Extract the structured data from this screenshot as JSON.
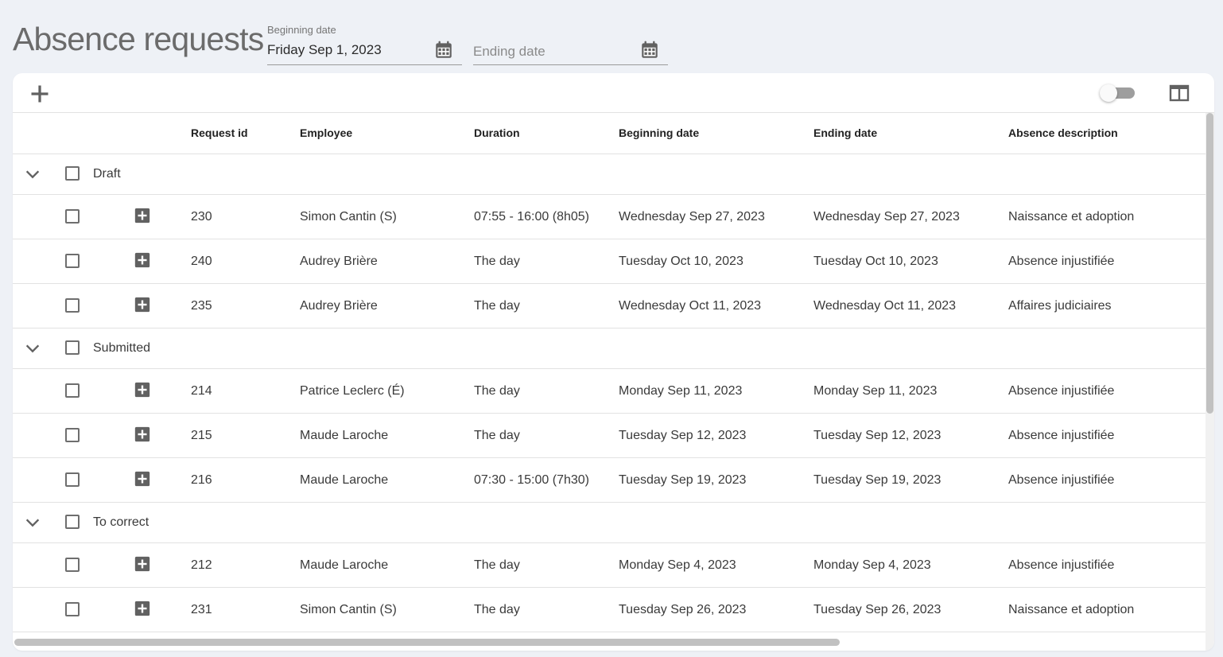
{
  "page": {
    "title": "Absence requests"
  },
  "filters": {
    "beginning": {
      "label": "Beginning date",
      "value": "Friday Sep 1, 2023"
    },
    "ending": {
      "placeholder": "Ending date"
    }
  },
  "table": {
    "columns": {
      "request_id": "Request id",
      "employee": "Employee",
      "duration": "Duration",
      "beginning_date": "Beginning date",
      "ending_date": "Ending date",
      "absence_description": "Absence description"
    },
    "groups": [
      {
        "name": "Draft",
        "rows": [
          {
            "id": "230",
            "employee": "Simon Cantin (S)",
            "duration": "07:55 - 16:00  (8h05)",
            "begin": "Wednesday Sep 27, 2023",
            "end": "Wednesday Sep 27, 2023",
            "desc": "Naissance et adoption"
          },
          {
            "id": "240",
            "employee": "Audrey Brière",
            "duration": "The day",
            "begin": "Tuesday Oct 10, 2023",
            "end": "Tuesday Oct 10, 2023",
            "desc": "Absence injustifiée"
          },
          {
            "id": "235",
            "employee": "Audrey Brière",
            "duration": "The day",
            "begin": "Wednesday Oct 11, 2023",
            "end": "Wednesday Oct 11, 2023",
            "desc": "Affaires judiciaires"
          }
        ]
      },
      {
        "name": "Submitted",
        "rows": [
          {
            "id": "214",
            "employee": "Patrice Leclerc (É)",
            "duration": "The day",
            "begin": "Monday Sep 11, 2023",
            "end": "Monday Sep 11, 2023",
            "desc": "Absence injustifiée"
          },
          {
            "id": "215",
            "employee": "Maude Laroche",
            "duration": "The day",
            "begin": "Tuesday Sep 12, 2023",
            "end": "Tuesday Sep 12, 2023",
            "desc": "Absence injustifiée"
          },
          {
            "id": "216",
            "employee": "Maude Laroche",
            "duration": "07:30 - 15:00  (7h30)",
            "begin": "Tuesday Sep 19, 2023",
            "end": "Tuesday Sep 19, 2023",
            "desc": "Absence injustifiée"
          }
        ]
      },
      {
        "name": "To correct",
        "rows": [
          {
            "id": "212",
            "employee": "Maude Laroche",
            "duration": "The day",
            "begin": "Monday Sep 4, 2023",
            "end": "Monday Sep 4, 2023",
            "desc": "Absence injustifiée"
          },
          {
            "id": "231",
            "employee": "Simon Cantin (S)",
            "duration": "The day",
            "begin": "Tuesday Sep 26, 2023",
            "end": "Tuesday Sep 26, 2023",
            "desc": "Naissance et adoption"
          }
        ]
      }
    ]
  },
  "icons": {
    "add": "plus-icon",
    "toggle": "toggle-switch",
    "columns": "view-column-icon",
    "calendar": "calendar-icon",
    "group_toggle": "chevron-down-icon",
    "row_expand": "plus-box-icon"
  },
  "colors": {
    "background": "#eef1f6",
    "card": "#ffffff",
    "icon": "#616161",
    "divider": "#e2e2e2"
  }
}
